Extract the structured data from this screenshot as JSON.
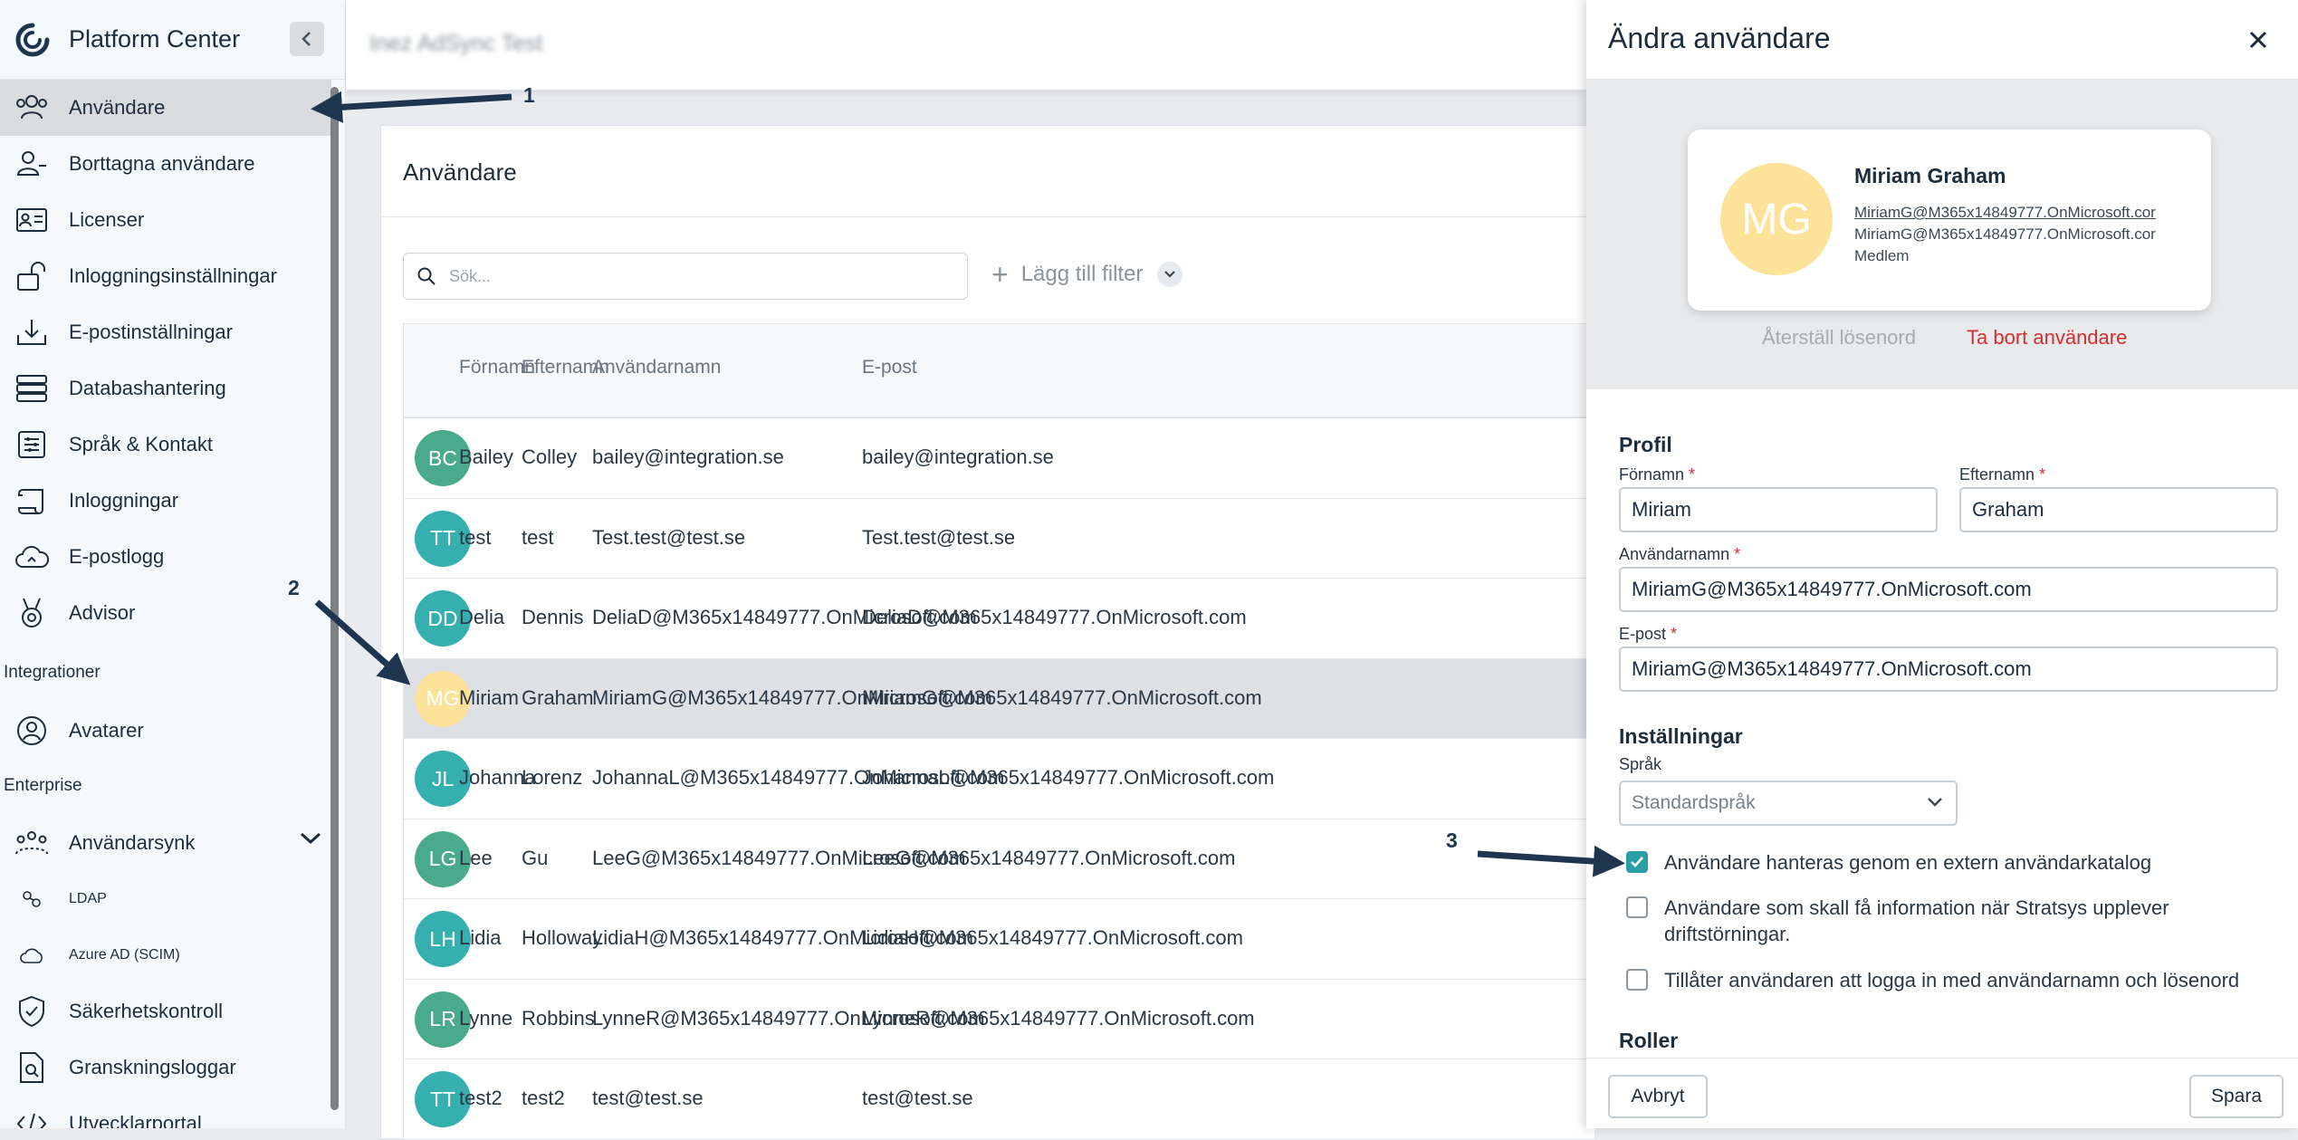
{
  "app": {
    "title": "Platform Center",
    "page_title": "Inez AdSync Test"
  },
  "sidebar": {
    "items": [
      {
        "label": "Användare",
        "icon": "users-icon",
        "active": true
      },
      {
        "label": "Borttagna användare",
        "icon": "user-minus-icon"
      },
      {
        "label": "Licenser",
        "icon": "license-card-icon"
      },
      {
        "label": "Inloggningsinställningar",
        "icon": "unlock-icon"
      },
      {
        "label": "E-postinställningar",
        "icon": "download-tray-icon"
      },
      {
        "label": "Databashantering",
        "icon": "server-icon"
      },
      {
        "label": "Språk & Kontakt",
        "icon": "sliders-icon"
      },
      {
        "label": "Inloggningar",
        "icon": "scroll-icon"
      },
      {
        "label": "E-postlogg",
        "icon": "cloud-icon"
      },
      {
        "label": "Advisor",
        "icon": "medal-icon"
      }
    ],
    "section_integrations": "Integrationer",
    "integrations": [
      {
        "label": "Avatarer",
        "icon": "user-circle-icon"
      }
    ],
    "section_enterprise": "Enterprise",
    "enterprise": [
      {
        "label": "Användarsynk",
        "icon": "user-group-icon"
      },
      {
        "label": "LDAP",
        "icon": "network-icon"
      },
      {
        "label": "Azure AD (SCIM)",
        "icon": "cloud-icon"
      },
      {
        "label": "Säkerhetskontroll",
        "icon": "shield-check-icon"
      },
      {
        "label": "Granskningsloggar",
        "icon": "document-search-icon"
      },
      {
        "label": "Utvecklarportal",
        "icon": "code-icon"
      }
    ]
  },
  "main": {
    "title": "Användare",
    "search_placeholder": "Sök...",
    "add_filter": "Lägg till filter",
    "columns": [
      "Förnamn",
      "Efternamn",
      "Användarnamn",
      "E-post"
    ],
    "rows": [
      {
        "initials": "BC",
        "color": "#4aaa8c",
        "first": "Bailey",
        "last": "Colley",
        "username": "bailey@integration.se",
        "email": "bailey@integration.se"
      },
      {
        "initials": "TT",
        "color": "#36b0ae",
        "first": "test",
        "last": "test",
        "username": "Test.test@test.se",
        "email": "Test.test@test.se"
      },
      {
        "initials": "DD",
        "color": "#36b0ae",
        "first": "Delia",
        "last": "Dennis",
        "username": "DeliaD@M365x14849777.OnMicrosoft.com",
        "email": "DeliaD@M365x14849777.OnMicrosoft.com"
      },
      {
        "initials": "MG",
        "color": "#fde29a",
        "first": "Miriam",
        "last": "Graham",
        "username": "MiriamG@M365x14849777.OnMicrosoft.com",
        "email": "MiriamG@M365x14849777.OnMicrosoft.com",
        "selected": true
      },
      {
        "initials": "JL",
        "color": "#36b0ae",
        "first": "Johanna",
        "last": "Lorenz",
        "username": "JohannaL@M365x14849777.OnMicrosoft.com",
        "email": "JohannaL@M365x14849777.OnMicrosoft.com"
      },
      {
        "initials": "LG",
        "color": "#4aaa8c",
        "first": "Lee",
        "last": "Gu",
        "username": "LeeG@M365x14849777.OnMicrosoft.com",
        "email": "LeeG@M365x14849777.OnMicrosoft.com"
      },
      {
        "initials": "LH",
        "color": "#36b0ae",
        "first": "Lidia",
        "last": "Holloway",
        "username": "LidiaH@M365x14849777.OnMicrosoft.com",
        "email": "LidiaH@M365x14849777.OnMicrosoft.com"
      },
      {
        "initials": "LR",
        "color": "#4aaa8c",
        "first": "Lynne",
        "last": "Robbins",
        "username": "LynneR@M365x14849777.OnMicrosoft.com",
        "email": "LynneR@M365x14849777.OnMicrosoft.com"
      },
      {
        "initials": "TT",
        "color": "#36b0ae",
        "first": "test2",
        "last": "test2",
        "username": "test@test.se",
        "email": "test@test.se"
      }
    ]
  },
  "drawer": {
    "title": "Ändra användare",
    "profile_card": {
      "initials": "MG",
      "name": "Miriam Graham",
      "line1": "MiriamG@M365x14849777.OnMicrosoft.cor",
      "line2": "MiriamG@M365x14849777.OnMicrosoft.cor",
      "role": "Medlem"
    },
    "reset_password": "Återställ lösenord",
    "delete_user": "Ta bort användare",
    "profile_section": "Profil",
    "firstname_label": "Förnamn",
    "firstname_value": "Miriam",
    "lastname_label": "Efternamn",
    "lastname_value": "Graham",
    "username_label": "Användarnamn",
    "username_value": "MiriamG@M365x14849777.OnMicrosoft.com",
    "email_label": "E-post",
    "email_value": "MiriamG@M365x14849777.OnMicrosoft.com",
    "required_mark": "*",
    "settings_section": "Inställningar",
    "language_label": "Språk",
    "language_value": "Standardspråk",
    "checkboxes": [
      {
        "label": "Användare hanteras genom en extern användarkatalog",
        "checked": true
      },
      {
        "label": "Användare som skall få information när Stratsys upplever driftstörningar.",
        "checked": false
      },
      {
        "label": "Tillåter användaren att logga in med användarnamn och lösenord",
        "checked": false
      }
    ],
    "roles_section": "Roller",
    "cancel": "Avbryt",
    "save": "Spara"
  },
  "annotations": [
    "1",
    "2",
    "3"
  ],
  "colors": {
    "accent": "#2a9fa8",
    "danger": "#d32f2f",
    "arrow": "#1e3550"
  }
}
